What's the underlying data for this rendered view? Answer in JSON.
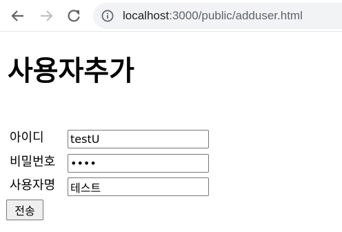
{
  "browser": {
    "url_host": "localhost",
    "url_path": ":3000/public/adduser.html"
  },
  "page": {
    "title": "사용자추가"
  },
  "form": {
    "id_label": "아이디",
    "id_value": "testU",
    "password_label": "비밀번호",
    "password_value": "1234",
    "name_label": "사용자명",
    "name_value": "테스트",
    "submit_label": "전송"
  },
  "icons": {
    "back": "arrow-left-icon",
    "forward": "arrow-right-icon",
    "reload": "reload-icon",
    "site_info": "info-icon"
  },
  "colors": {
    "omnibox_bg": "#f1f3f4",
    "button_bg": "#efefef",
    "input_border": "#767676"
  }
}
